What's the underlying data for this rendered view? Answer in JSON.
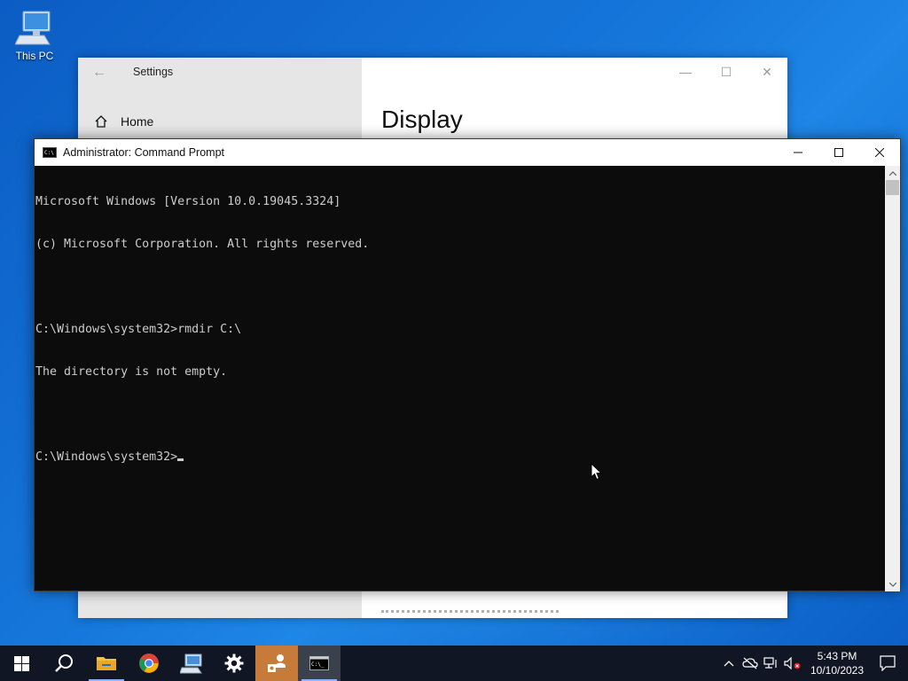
{
  "desktop": {
    "icons": [
      {
        "label": "This PC",
        "icon": "computer-icon"
      }
    ]
  },
  "settings_window": {
    "title": "Settings",
    "nav_home": "Home",
    "heading": "Display"
  },
  "cmd_window": {
    "title": "Administrator: Command Prompt",
    "lines": [
      "Microsoft Windows [Version 10.0.19045.3324]",
      "(c) Microsoft Corporation. All rights reserved.",
      "",
      "C:\\Windows\\system32>rmdir C:\\",
      "The directory is not empty.",
      "",
      "C:\\Windows\\system32>"
    ]
  },
  "taskbar": {
    "items": [
      {
        "name": "start",
        "icon": "windows-logo-icon"
      },
      {
        "name": "search",
        "icon": "search-icon"
      },
      {
        "name": "file-explorer",
        "icon": "folder-icon"
      },
      {
        "name": "chrome",
        "icon": "chrome-icon"
      },
      {
        "name": "network-app",
        "icon": "network-computer-icon"
      },
      {
        "name": "settings",
        "icon": "gear-icon"
      },
      {
        "name": "user-app",
        "icon": "people-icon"
      },
      {
        "name": "command-prompt",
        "icon": "terminal-icon"
      }
    ],
    "clock": {
      "time": "5:43 PM",
      "date": "10/10/2023"
    }
  },
  "colors": {
    "desktop_blue": "#0a63c9",
    "console_bg": "#0c0c0c",
    "console_text": "#cccccc",
    "taskbar_bg": "#101623",
    "highlight_app": "#c77b3a"
  }
}
